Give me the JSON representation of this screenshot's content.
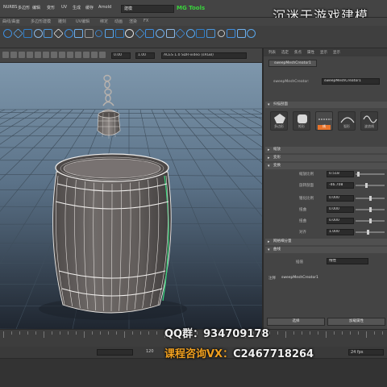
{
  "menubar": {
    "items": [
      "NURBS",
      "多边形",
      "编辑",
      "变形",
      "UV",
      "生成",
      "缓存",
      "Arnold",
      "帮助"
    ],
    "mode_value": "建模",
    "plugin_label": "MG Tools"
  },
  "watermark": {
    "top": "沉迷于游戏建模",
    "qq": "QQ群：934709178",
    "course_label": "课程咨询VX：",
    "course_id": "C2467718264"
  },
  "shelf": {
    "tabs": [
      "曲线/曲面",
      "多边形建模",
      "雕刻",
      "UV编辑",
      "绑定",
      "动画",
      "渲染",
      "FX"
    ]
  },
  "viewport": {
    "value_a": "0.00",
    "value_b": "1.00",
    "camera": "ACES 1.0 SDR-video (sRGB)"
  },
  "attribute_editor": {
    "tabs": [
      "列表",
      "选定",
      "焦点",
      "属性",
      "显示",
      "显示"
    ],
    "node_tab": "sweepMeshCreator1",
    "node_label": "sweepMeshCreator:",
    "node_value": "sweepMeshCreator1",
    "sections": {
      "shapes": "扫描剖面",
      "section2": "缩放",
      "section3": "变形",
      "section4": "变换",
      "section5": "网格细分量",
      "section6": "曲线"
    },
    "shapes": [
      {
        "label": "多边形"
      },
      {
        "label": "矩形"
      },
      {
        "label": "线"
      },
      {
        "label": "弧形"
      },
      {
        "label": "波浪线"
      }
    ],
    "rows": [
      {
        "label": "缩放比例",
        "value": "0.518"
      },
      {
        "label": "旋转剖面",
        "value": "-46.708"
      },
      {
        "label": "锥化比例",
        "value": "0.000"
      },
      {
        "label": "扭曲",
        "value": "0.000"
      },
      {
        "label": "扭曲",
        "value": "0.000"
      },
      {
        "label": "对齐",
        "value": "1.000"
      }
    ],
    "interp_label": "插值",
    "interp_value": "线性",
    "comment_label": "注释",
    "comment_value": "sweepMeshCreator1",
    "select_button": "选择",
    "load_button": "加载属性"
  },
  "timeline": {
    "start": "120",
    "fps": "24 fps"
  }
}
